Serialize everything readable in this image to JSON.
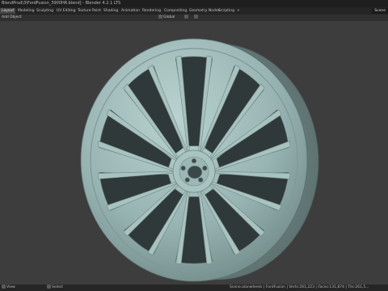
{
  "window": {
    "title": "BlendProd\\3\\FordFusion_3900HR.blend] - Blender 4.2.1 LTS"
  },
  "workspaces": [
    {
      "label": "Layout"
    },
    {
      "label": "Modeling"
    },
    {
      "label": "Sculpting"
    },
    {
      "label": "UV Editing"
    },
    {
      "label": "Texture Paint"
    },
    {
      "label": "Shading"
    },
    {
      "label": "Animation"
    },
    {
      "label": "Rendering"
    },
    {
      "label": "Compositing"
    },
    {
      "label": "Geometry Nodes"
    },
    {
      "label": "Scripting"
    },
    {
      "label": "+"
    }
  ],
  "scene": {
    "label": "Scene"
  },
  "header": {
    "add": "Add",
    "object": "Object",
    "transform": "Global"
  },
  "status": {
    "left": "View",
    "select": "Select",
    "stats": "Scene.alanwheels | FordFusion | Verts:261,223 | Faces:131,874 | Tris:261,5..."
  }
}
